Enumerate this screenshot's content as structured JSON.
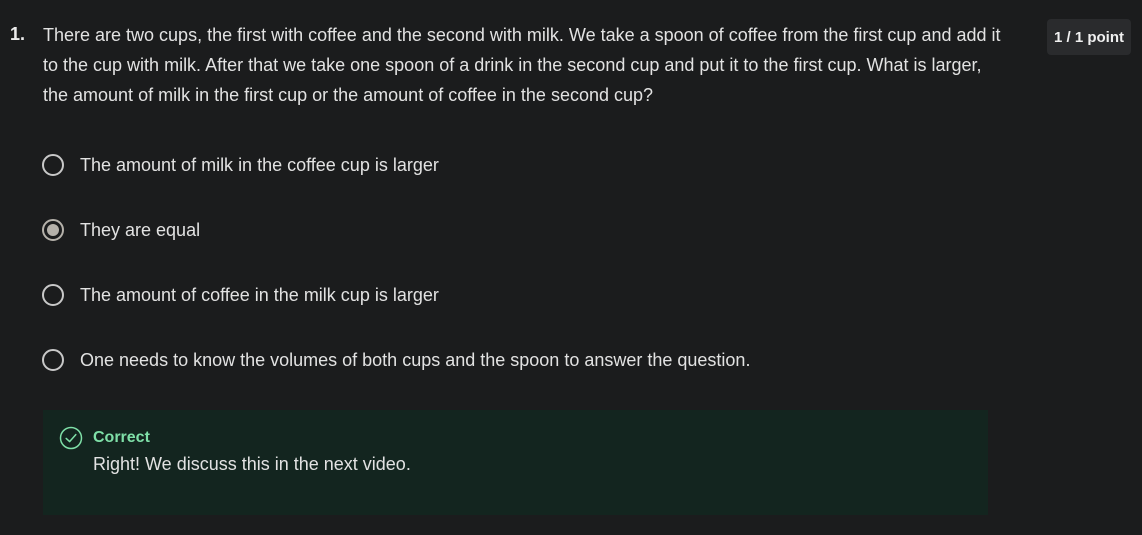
{
  "question": {
    "number": "1.",
    "text": "There are two cups, the first with coffee and the second with milk. We take a spoon of coffee from the first cup and add it to the cup with milk. After that we take one spoon of a drink in the second cup and put it to the first cup. What is larger, the amount of milk in the first cup or the amount of coffee in the second cup?",
    "score": "1 / 1 point"
  },
  "options": [
    {
      "label": "The amount of milk in the coffee cup is larger",
      "selected": false
    },
    {
      "label": "They are equal",
      "selected": true
    },
    {
      "label": "The amount of coffee in the milk cup is larger",
      "selected": false
    },
    {
      "label": "One needs to know the volumes of both cups and the spoon to answer the question.",
      "selected": false
    }
  ],
  "feedback": {
    "status": "Correct",
    "message": "Right! We discuss this in the next video.",
    "icon": "check-circle-icon",
    "accent_color": "#7fe0a8",
    "background_color": "#13251f"
  }
}
